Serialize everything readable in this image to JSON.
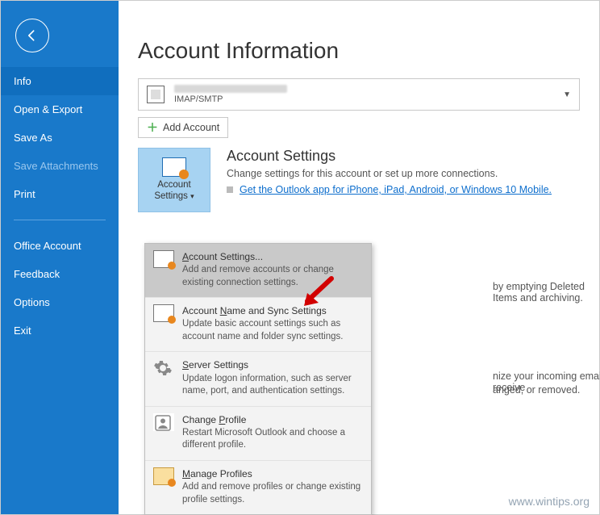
{
  "sidebar": {
    "items": [
      {
        "label": "Info"
      },
      {
        "label": "Open & Export"
      },
      {
        "label": "Save As"
      },
      {
        "label": "Save Attachments"
      },
      {
        "label": "Print"
      },
      {
        "label": "Office Account"
      },
      {
        "label": "Feedback"
      },
      {
        "label": "Options"
      },
      {
        "label": "Exit"
      }
    ]
  },
  "page": {
    "title": "Account Information",
    "account_type": "IMAP/SMTP",
    "add_account": "Add Account"
  },
  "tile": {
    "line1": "Account",
    "line2": "Settings"
  },
  "settings_text": {
    "h": "Account Settings",
    "sub": "Change settings for this account or set up more connections.",
    "link": "Get the Outlook app for iPhone, iPad, Android, or Windows 10 Mobile."
  },
  "dropdown": [
    {
      "title_pre": "",
      "title_u": "A",
      "title_post": "ccount Settings...",
      "desc": "Add and remove accounts or change existing connection settings."
    },
    {
      "title_pre": "Account ",
      "title_u": "N",
      "title_post": "ame and Sync Settings",
      "desc": "Update basic account settings such as account name and folder sync settings."
    },
    {
      "title_pre": "",
      "title_u": "S",
      "title_post": "erver Settings",
      "desc": "Update logon information, such as server name, port, and authentication settings."
    },
    {
      "title_pre": "Change ",
      "title_u": "P",
      "title_post": "rofile",
      "desc": "Restart Microsoft Outlook and choose a different profile."
    },
    {
      "title_pre": "",
      "title_u": "M",
      "title_post": "anage Profiles",
      "desc": "Add and remove profiles or change existing profile settings."
    }
  ],
  "bg_partial": {
    "line1": "by emptying Deleted Items and archiving.",
    "line2": "nize your incoming email messages, and receive",
    "line3": "anged, or removed."
  },
  "watermark": "www.wintips.org"
}
